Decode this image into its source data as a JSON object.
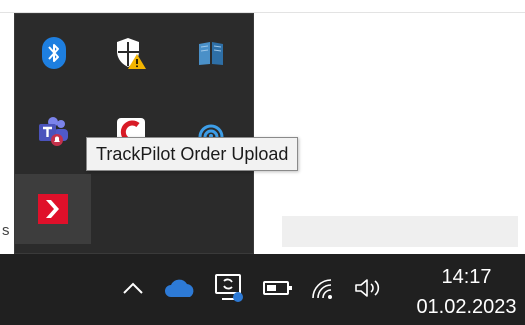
{
  "tooltip": {
    "text": "TrackPilot Order Upload"
  },
  "background": {
    "partial_text": "s"
  },
  "overflow_icons": [
    {
      "name": "bluetooth-icon"
    },
    {
      "name": "windows-security-warning-icon"
    },
    {
      "name": "book-icon"
    },
    {
      "name": "teams-icon"
    },
    {
      "name": "red-c-app-icon"
    },
    {
      "name": "blue-swirl-app-icon"
    },
    {
      "name": "trackpilot-icon"
    }
  ],
  "taskbar": {
    "icons": [
      {
        "name": "chevron-up-icon"
      },
      {
        "name": "onedrive-cloud-icon"
      },
      {
        "name": "sync-device-icon"
      },
      {
        "name": "battery-icon"
      },
      {
        "name": "wifi-icon"
      },
      {
        "name": "speaker-icon"
      }
    ],
    "clock": {
      "time": "14:17",
      "date": "01.02.2023"
    }
  },
  "colors": {
    "taskbar_bg": "#202020",
    "flyout_bg": "#2b2b2b",
    "bluetooth_blue": "#1e7fe0",
    "onedrive_blue": "#2d7ad6",
    "trackpilot_red": "#e0102a"
  }
}
